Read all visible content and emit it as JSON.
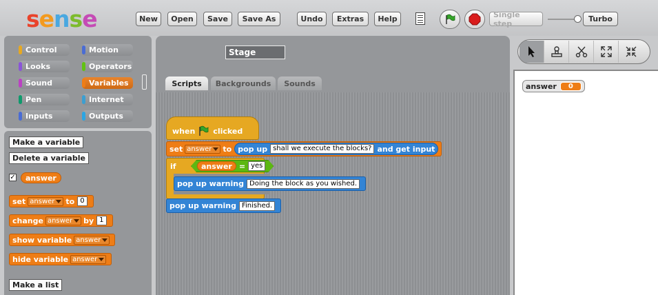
{
  "app": {
    "logo": "sense"
  },
  "toolbar": {
    "new": "New",
    "open": "Open",
    "save": "Save",
    "save_as": "Save As",
    "undo": "Undo",
    "extras": "Extras",
    "help": "Help",
    "single_step": "Single step",
    "turbo": "Turbo"
  },
  "colors": {
    "accent_orange": "#ee7d16",
    "control": "#e6a822",
    "looks": "#8a55d7",
    "sound": "#bb42c3",
    "pen": "#0e9a6c",
    "inputs": "#4a6cd4",
    "motion": "#4a6cd4",
    "operators": "#62c213",
    "variables": "#ee7d16",
    "internet": "#3c9fd1",
    "outputs": "#2ca5e2"
  },
  "categories": {
    "control": "Control",
    "motion": "Motion",
    "looks": "Looks",
    "operators": "Operators",
    "sound": "Sound",
    "variables": "Variables",
    "pen": "Pen",
    "internet": "Internet",
    "inputs": "Inputs",
    "outputs": "Outputs"
  },
  "palette": {
    "make_variable": "Make a variable",
    "delete_variable": "Delete a variable",
    "var_name": "answer",
    "var_checked": true,
    "set_label": "set",
    "set_to": "to",
    "set_value": "0",
    "change_label": "change",
    "change_by": "by",
    "change_value": "1",
    "show_label": "show variable",
    "hide_label": "hide variable",
    "dropdown_var": "answer",
    "make_list": "Make a list"
  },
  "sprite": {
    "name": "Stage"
  },
  "tabs": {
    "scripts": "Scripts",
    "backgrounds": "Backgrounds",
    "sounds": "Sounds"
  },
  "script": {
    "when": "when",
    "clicked": "clicked",
    "set": "set",
    "var": "answer",
    "to": "to",
    "popup": "pop up",
    "question": "shall we execute the blocks?",
    "get_input": "and get input",
    "if": "if",
    "eq": "=",
    "yes": "yes",
    "warning": "pop up warning",
    "warn_text1": "Doing the block as you wished.",
    "warn_text2": "Finished."
  },
  "stage": {
    "watcher_label": "answer",
    "watcher_value": "0"
  }
}
